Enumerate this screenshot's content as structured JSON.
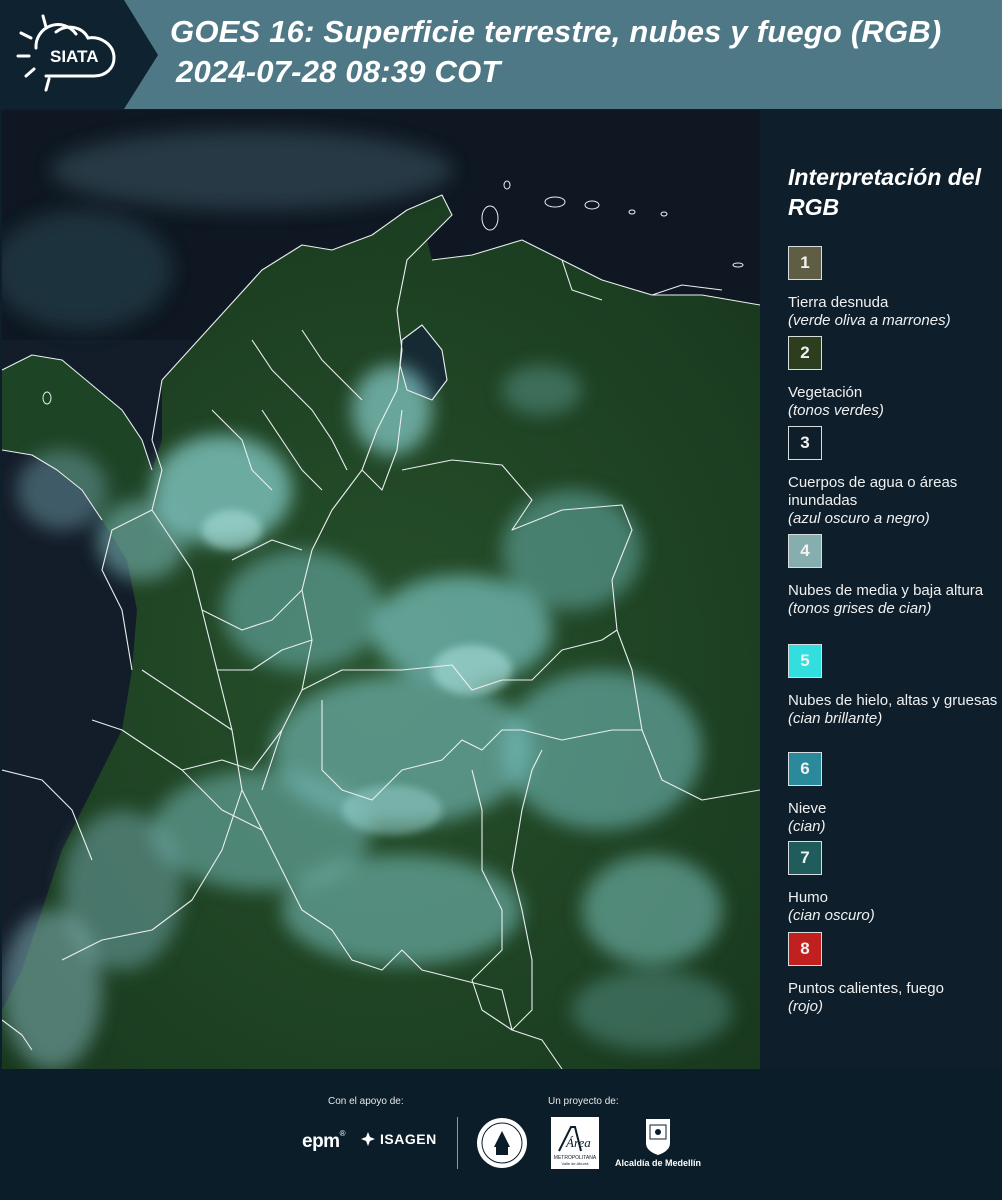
{
  "header": {
    "logo_text": "SIATA",
    "title": "GOES 16: Superficie terrestre, nubes y fuego (RGB)",
    "datetime": "2024-07-28 08:39 COT"
  },
  "legend": {
    "title": "Interpretación del RGB",
    "items": [
      {
        "number": "1",
        "label": "Tierra desnuda",
        "sub": "(verde oliva a marrones)",
        "color": "#5f5e44"
      },
      {
        "number": "2",
        "label": "Vegetación",
        "sub": "(tonos verdes)",
        "color": "#2c3e1e"
      },
      {
        "number": "3",
        "label": "Cuerpos de agua o áreas inundadas",
        "sub": "(azul oscuro a negro)",
        "color": "#0e1f2b"
      },
      {
        "number": "4",
        "label": "Nubes de media y baja altura",
        "sub": "(tonos grises de cian)",
        "color": "#87aeae"
      },
      {
        "number": "5",
        "label": "Nubes de hielo, altas y gruesas",
        "sub": "(cian brillante)",
        "color": "#33dede"
      },
      {
        "number": "6",
        "label": "Nieve",
        "sub": "(cian)",
        "color": "#2a8a9c"
      },
      {
        "number": "7",
        "label": "Humo",
        "sub": "(cian oscuro)",
        "color": "#205c5c"
      },
      {
        "number": "8",
        "label": "Puntos calientes, fuego",
        "sub": "(rojo)",
        "color": "#c0201e"
      }
    ]
  },
  "footer": {
    "support_label": "Con el apoyo de:",
    "project_label": "Un proyecto de:",
    "epm": "epm",
    "epm_mark": "®",
    "isagen": "ISAGEN",
    "area_logo_text": "Área",
    "area_logo_sub": "METROPOLITANA",
    "area_logo_sub2": "Valle de Aburrá",
    "alcaldia": "Alcaldía de Medellín"
  },
  "colors": {
    "header_bg": "#4f7886",
    "panel_bg": "#0e1f2b",
    "map_land": "#1d4224",
    "map_ocean": "#121c28",
    "cloud": "#7ccacb"
  }
}
